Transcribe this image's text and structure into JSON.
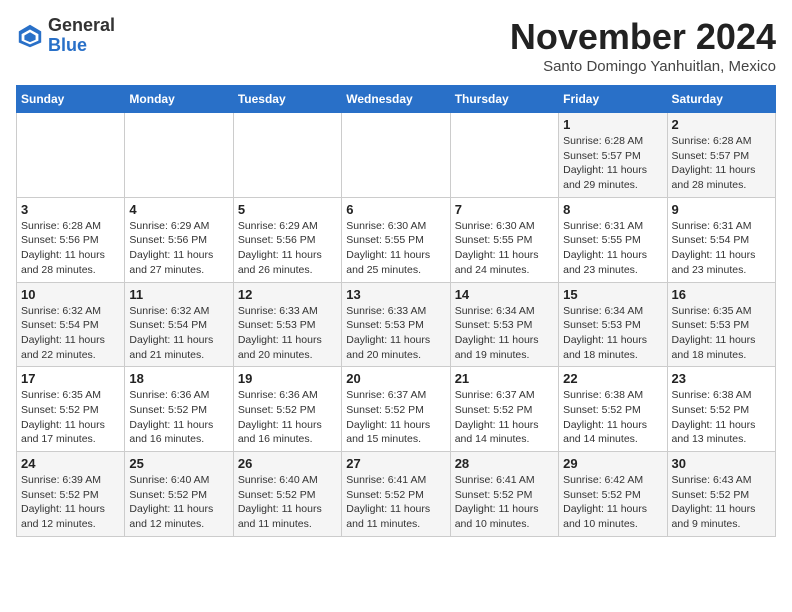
{
  "header": {
    "logo_general": "General",
    "logo_blue": "Blue",
    "month": "November 2024",
    "location": "Santo Domingo Yanhuitlan, Mexico"
  },
  "weekdays": [
    "Sunday",
    "Monday",
    "Tuesday",
    "Wednesday",
    "Thursday",
    "Friday",
    "Saturday"
  ],
  "weeks": [
    [
      {
        "day": "",
        "info": ""
      },
      {
        "day": "",
        "info": ""
      },
      {
        "day": "",
        "info": ""
      },
      {
        "day": "",
        "info": ""
      },
      {
        "day": "",
        "info": ""
      },
      {
        "day": "1",
        "info": "Sunrise: 6:28 AM\nSunset: 5:57 PM\nDaylight: 11 hours\nand 29 minutes."
      },
      {
        "day": "2",
        "info": "Sunrise: 6:28 AM\nSunset: 5:57 PM\nDaylight: 11 hours\nand 28 minutes."
      }
    ],
    [
      {
        "day": "3",
        "info": "Sunrise: 6:28 AM\nSunset: 5:56 PM\nDaylight: 11 hours\nand 28 minutes."
      },
      {
        "day": "4",
        "info": "Sunrise: 6:29 AM\nSunset: 5:56 PM\nDaylight: 11 hours\nand 27 minutes."
      },
      {
        "day": "5",
        "info": "Sunrise: 6:29 AM\nSunset: 5:56 PM\nDaylight: 11 hours\nand 26 minutes."
      },
      {
        "day": "6",
        "info": "Sunrise: 6:30 AM\nSunset: 5:55 PM\nDaylight: 11 hours\nand 25 minutes."
      },
      {
        "day": "7",
        "info": "Sunrise: 6:30 AM\nSunset: 5:55 PM\nDaylight: 11 hours\nand 24 minutes."
      },
      {
        "day": "8",
        "info": "Sunrise: 6:31 AM\nSunset: 5:55 PM\nDaylight: 11 hours\nand 23 minutes."
      },
      {
        "day": "9",
        "info": "Sunrise: 6:31 AM\nSunset: 5:54 PM\nDaylight: 11 hours\nand 23 minutes."
      }
    ],
    [
      {
        "day": "10",
        "info": "Sunrise: 6:32 AM\nSunset: 5:54 PM\nDaylight: 11 hours\nand 22 minutes."
      },
      {
        "day": "11",
        "info": "Sunrise: 6:32 AM\nSunset: 5:54 PM\nDaylight: 11 hours\nand 21 minutes."
      },
      {
        "day": "12",
        "info": "Sunrise: 6:33 AM\nSunset: 5:53 PM\nDaylight: 11 hours\nand 20 minutes."
      },
      {
        "day": "13",
        "info": "Sunrise: 6:33 AM\nSunset: 5:53 PM\nDaylight: 11 hours\nand 20 minutes."
      },
      {
        "day": "14",
        "info": "Sunrise: 6:34 AM\nSunset: 5:53 PM\nDaylight: 11 hours\nand 19 minutes."
      },
      {
        "day": "15",
        "info": "Sunrise: 6:34 AM\nSunset: 5:53 PM\nDaylight: 11 hours\nand 18 minutes."
      },
      {
        "day": "16",
        "info": "Sunrise: 6:35 AM\nSunset: 5:53 PM\nDaylight: 11 hours\nand 18 minutes."
      }
    ],
    [
      {
        "day": "17",
        "info": "Sunrise: 6:35 AM\nSunset: 5:52 PM\nDaylight: 11 hours\nand 17 minutes."
      },
      {
        "day": "18",
        "info": "Sunrise: 6:36 AM\nSunset: 5:52 PM\nDaylight: 11 hours\nand 16 minutes."
      },
      {
        "day": "19",
        "info": "Sunrise: 6:36 AM\nSunset: 5:52 PM\nDaylight: 11 hours\nand 16 minutes."
      },
      {
        "day": "20",
        "info": "Sunrise: 6:37 AM\nSunset: 5:52 PM\nDaylight: 11 hours\nand 15 minutes."
      },
      {
        "day": "21",
        "info": "Sunrise: 6:37 AM\nSunset: 5:52 PM\nDaylight: 11 hours\nand 14 minutes."
      },
      {
        "day": "22",
        "info": "Sunrise: 6:38 AM\nSunset: 5:52 PM\nDaylight: 11 hours\nand 14 minutes."
      },
      {
        "day": "23",
        "info": "Sunrise: 6:38 AM\nSunset: 5:52 PM\nDaylight: 11 hours\nand 13 minutes."
      }
    ],
    [
      {
        "day": "24",
        "info": "Sunrise: 6:39 AM\nSunset: 5:52 PM\nDaylight: 11 hours\nand 12 minutes."
      },
      {
        "day": "25",
        "info": "Sunrise: 6:40 AM\nSunset: 5:52 PM\nDaylight: 11 hours\nand 12 minutes."
      },
      {
        "day": "26",
        "info": "Sunrise: 6:40 AM\nSunset: 5:52 PM\nDaylight: 11 hours\nand 11 minutes."
      },
      {
        "day": "27",
        "info": "Sunrise: 6:41 AM\nSunset: 5:52 PM\nDaylight: 11 hours\nand 11 minutes."
      },
      {
        "day": "28",
        "info": "Sunrise: 6:41 AM\nSunset: 5:52 PM\nDaylight: 11 hours\nand 10 minutes."
      },
      {
        "day": "29",
        "info": "Sunrise: 6:42 AM\nSunset: 5:52 PM\nDaylight: 11 hours\nand 10 minutes."
      },
      {
        "day": "30",
        "info": "Sunrise: 6:43 AM\nSunset: 5:52 PM\nDaylight: 11 hours\nand 9 minutes."
      }
    ]
  ]
}
